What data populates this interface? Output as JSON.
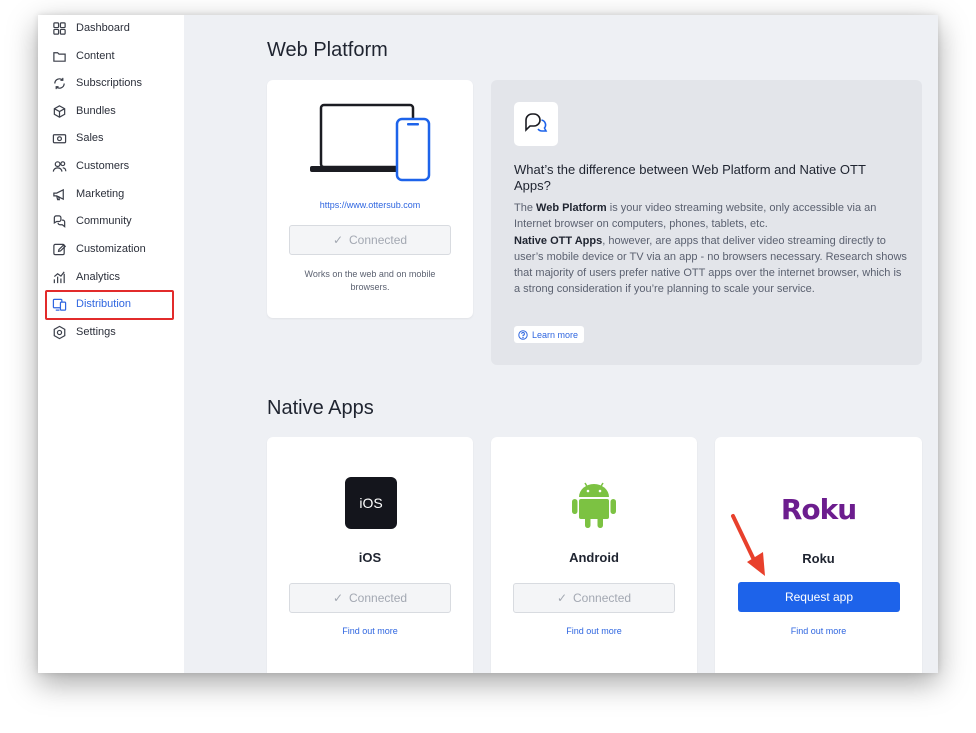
{
  "sidebar": {
    "items": [
      {
        "label": "Dashboard",
        "icon": "grid-icon"
      },
      {
        "label": "Content",
        "icon": "folder-icon"
      },
      {
        "label": "Subscriptions",
        "icon": "refresh-icon"
      },
      {
        "label": "Bundles",
        "icon": "cube-icon"
      },
      {
        "label": "Sales",
        "icon": "cash-icon"
      },
      {
        "label": "Customers",
        "icon": "users-icon"
      },
      {
        "label": "Marketing",
        "icon": "megaphone-icon"
      },
      {
        "label": "Community",
        "icon": "chat-icon"
      },
      {
        "label": "Customization",
        "icon": "edit-icon"
      },
      {
        "label": "Analytics",
        "icon": "chart-icon"
      },
      {
        "label": "Distribution",
        "icon": "devices-icon"
      },
      {
        "label": "Settings",
        "icon": "gear-icon"
      }
    ],
    "active": "Distribution"
  },
  "web_platform": {
    "title": "Web Platform",
    "url": "https://www.ottersub.com",
    "status": "Connected",
    "note": "Works on the web and on mobile browsers."
  },
  "info": {
    "title": "What’s the difference between Web Platform and Native OTT Apps?",
    "p1_prefix": "The ",
    "p1_bold": "Web Platform",
    "p1_rest": " is your video streaming website, only accessible via an Internet browser on computers, phones, tablets, etc.",
    "p2_bold": "Native OTT Apps",
    "p2_rest": ", however, are apps that deliver video streaming directly to user’s mobile device or TV via an app - no browsers necessary. Research shows that majority of users prefer native OTT apps over the internet browser, which is a strong consideration if you’re planning to scale your service.",
    "learn_more": "Learn more"
  },
  "native_apps": {
    "title": "Native Apps",
    "apps": [
      {
        "name": "iOS",
        "logo_text": "iOS",
        "status": "Connected",
        "link": "Find out more"
      },
      {
        "name": "Android",
        "status": "Connected",
        "link": "Find out more"
      },
      {
        "name": "Roku",
        "logo_text": "Roku",
        "action": "Request app",
        "link": "Find out more"
      }
    ]
  },
  "colors": {
    "accent": "#1d63ea",
    "highlight": "#e22b2b",
    "android": "#7cc242",
    "roku": "#6c1d8e"
  }
}
